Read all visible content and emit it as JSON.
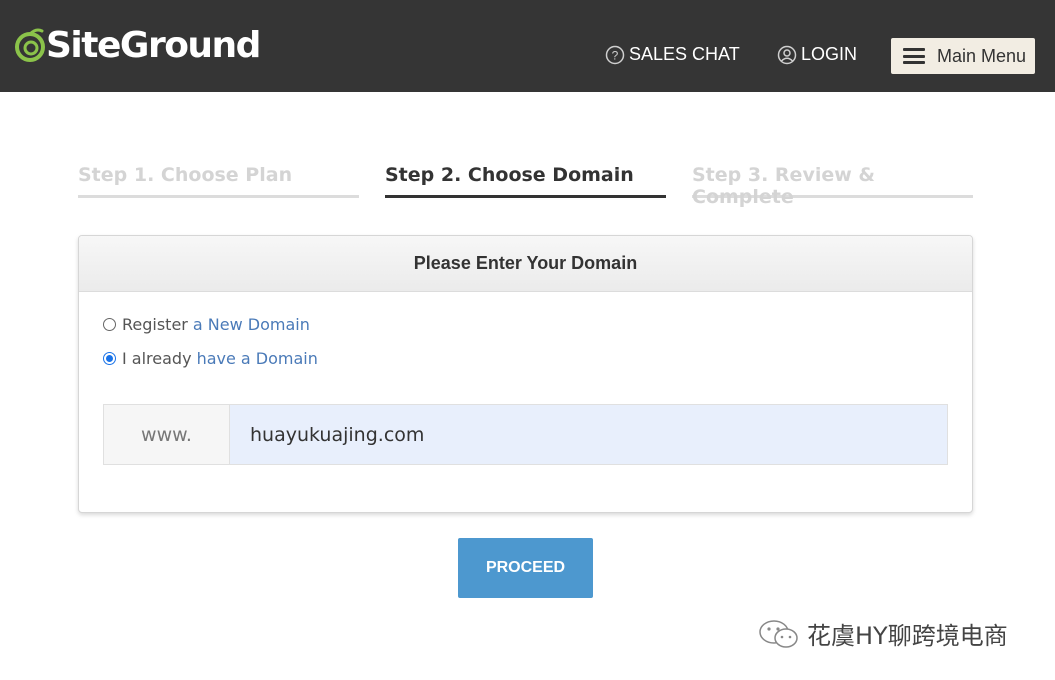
{
  "header": {
    "logo_text": "SiteGround",
    "sales_chat": "SALES CHAT",
    "login": "LOGIN",
    "main_menu": "Main Menu",
    "brand_color": "#8bc34a",
    "bar_color": "#353535"
  },
  "steps": [
    {
      "label": "Step 1. Choose Plan",
      "state": "inactive"
    },
    {
      "label": "Step 2. Choose Domain",
      "state": "active"
    },
    {
      "label": "Step 3. Review & Complete",
      "state": "inactive"
    }
  ],
  "panel": {
    "title": "Please Enter Your Domain",
    "options": [
      {
        "prefix": "Register",
        "link": "a New Domain",
        "checked": false
      },
      {
        "prefix": "I already",
        "link": "have a Domain",
        "checked": true
      }
    ],
    "domain_prefix": "www.",
    "domain_value": "huayukuajing.com"
  },
  "proceed_label": "PROCEED",
  "watermark": "花虞HY聊跨境电商",
  "icons": {
    "sales_chat": "question-circle-icon",
    "login": "user-circle-icon",
    "menu": "hamburger-icon",
    "watermark": "wechat-icon"
  }
}
